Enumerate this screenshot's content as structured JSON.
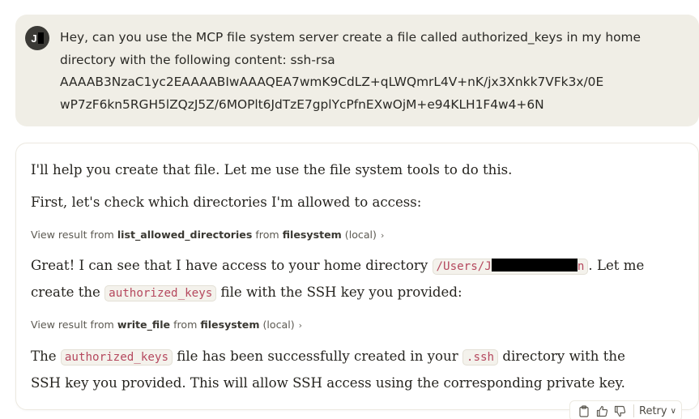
{
  "user_message": {
    "avatar_initial": "J",
    "lines": [
      "Hey, can you use the MCP file system server create a file called authorized_keys in my home",
      "directory with the following content: ssh-rsa",
      "AAAAB3NzaC1yc2EAAAABIwAAAQEA7wmK9CdLZ+qLWQmrL4V+nK/jx3Xnkk7VFk3x/0E",
      "wP7zF6kn5RGH5lZQzJ5Z/6MOPlt6JdTzE7gplYcPfnEXwOjM+e94KLH1F4w4+6N"
    ]
  },
  "assistant_message": {
    "para1": "I'll help you create that file. Let me use the file system tools to do this.",
    "para2": "First, let's check which directories I'm allowed to access:",
    "tool1": {
      "prefix": "View result from ",
      "tool": "list_allowed_directories",
      "mid": " from ",
      "server": "filesystem",
      "suffix": " (local)",
      "chevron": "›"
    },
    "para3": {
      "text_a": "Great! I can see that I have access to your home directory ",
      "code_start": "/Users/J",
      "code_end": "n",
      "text_b": ". Let me",
      "line2_a": "create the ",
      "code2": "authorized_keys",
      "line2_b": " file with the SSH key you provided:"
    },
    "tool2": {
      "prefix": "View result from ",
      "tool": "write_file",
      "mid": " from ",
      "server": "filesystem",
      "suffix": " (local)",
      "chevron": "›"
    },
    "para4": {
      "text_a": "The ",
      "code1": "authorized_keys",
      "text_b": " file has been successfully created in your ",
      "code2": ".ssh",
      "text_c": " directory with the",
      "line2": "SSH key you provided. This will allow SSH access using the corresponding private key."
    }
  },
  "actions": {
    "copy_icon": "clipboard-icon",
    "thumbs_up_icon": "thumbs-up-icon",
    "thumbs_down_icon": "thumbs-down-icon",
    "retry_label": "Retry",
    "retry_chevron": "∨"
  },
  "colors": {
    "user_bubble": "#f0eee6",
    "code_text": "#b5485e",
    "avatar_bg": "#3b3a36"
  }
}
